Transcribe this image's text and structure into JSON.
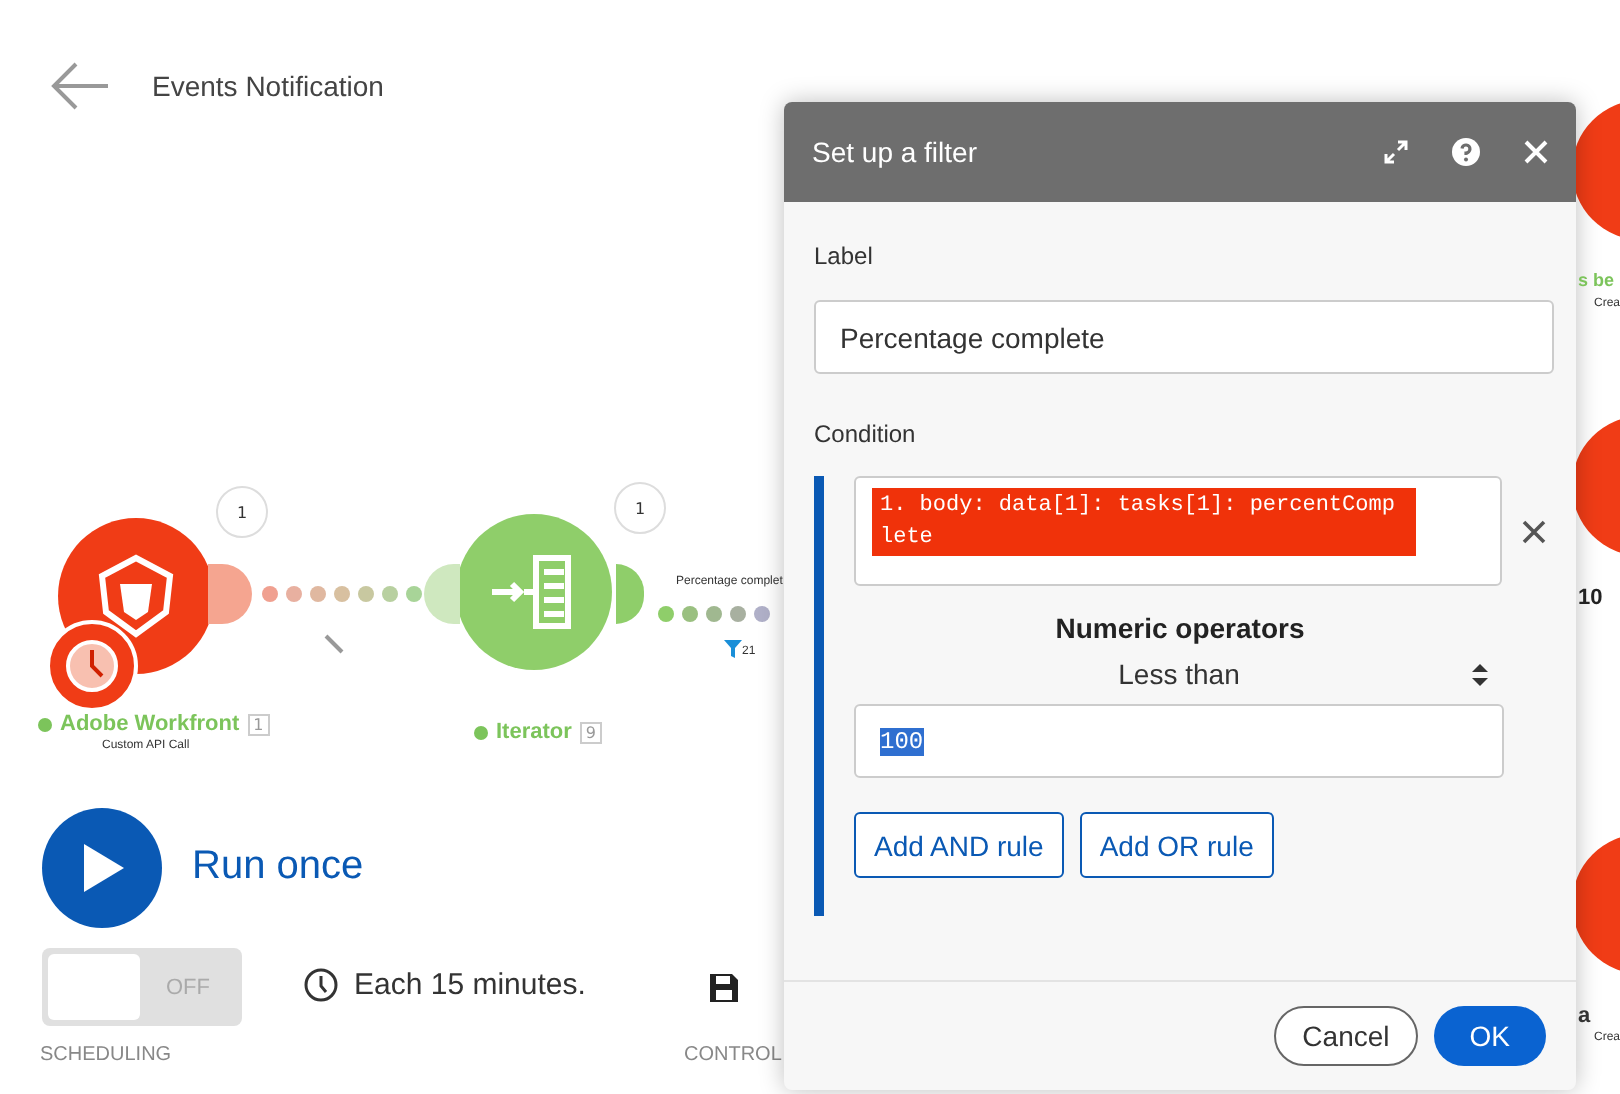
{
  "header": {
    "title": "Events Notification"
  },
  "nodes": [
    {
      "kind": "workfront",
      "name": "Adobe Workfront",
      "number": "1",
      "subtitle": "Custom API Call",
      "bubble": "1"
    },
    {
      "kind": "iterator",
      "name": "Iterator",
      "number": "9",
      "bubble": "1"
    }
  ],
  "link": {
    "label": "Percentage complet",
    "filter_count": "21"
  },
  "right_nodes": [
    {
      "name": "s be",
      "subtitle": "Crea"
    },
    {
      "name": "10"
    },
    {
      "name": "a",
      "subtitle": "Crea"
    }
  ],
  "run": {
    "label": "Run once"
  },
  "scheduling": {
    "on": false,
    "toggle_label": "OFF",
    "caption": "SCHEDULING",
    "interval": "Each 15 minutes."
  },
  "controls": {
    "caption": "CONTROL"
  },
  "dialog": {
    "title": "Set up a filter",
    "label_caption": "Label",
    "label_value": "Percentage complete",
    "condition_caption": "Condition",
    "rule": {
      "field": "1. body: data[1]: tasks[1]: percentComplete",
      "operator_group": "Numeric operators",
      "operator": "Less than",
      "value": "100",
      "value_selected": true
    },
    "rule_buttons": [
      "Add AND rule",
      "Add OR rule"
    ],
    "buttons": [
      {
        "kind": "cancel",
        "label": "Cancel"
      },
      {
        "kind": "ok",
        "label": "OK"
      }
    ]
  }
}
